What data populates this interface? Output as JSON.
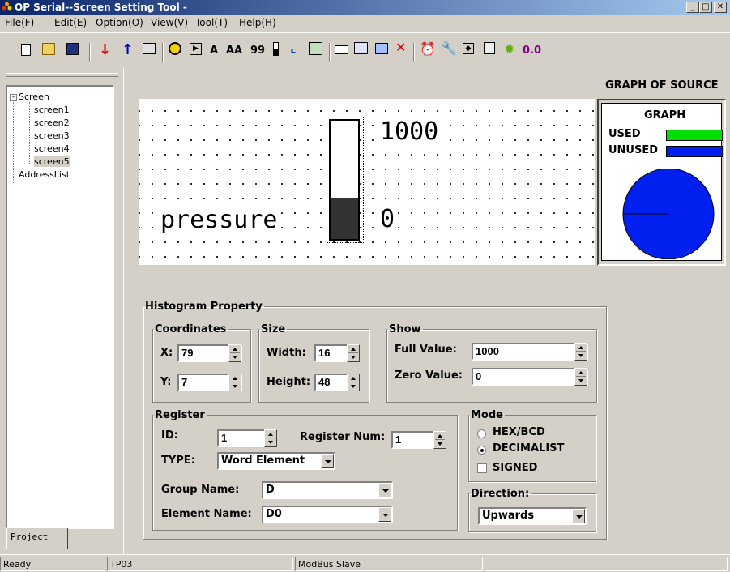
{
  "window": {
    "title": "OP Serial--Screen Setting Tool -"
  },
  "menu": [
    "File(F)",
    "Edit(E)",
    "Option(O)",
    "View(V)",
    "Tool(T)",
    "Help(H)"
  ],
  "toolbar": {
    "text_a": "A",
    "text_aa": "AA",
    "text_99": "99",
    "zoom_value": "0.0"
  },
  "tree": {
    "root": "Screen",
    "screens": [
      "screen1",
      "screen2",
      "screen3",
      "screen4",
      "screen5"
    ],
    "selected": "screen5",
    "address_list": "AddressList",
    "tab": "Project"
  },
  "canvas": {
    "label": "pressure",
    "full_label": "1000",
    "zero_label": "0",
    "bar_fill_fraction": 0.34
  },
  "source": {
    "title": "GRAPH OF SOURCE",
    "graph": "GRAPH",
    "used": "USED",
    "unused": "UNUSED",
    "used_color": "#00e000",
    "unused_color": "#0020f0",
    "used_fraction": 0.0
  },
  "props": {
    "title": "Histogram Property",
    "coordinates": {
      "title": "Coordinates",
      "x_label": "X:",
      "x": "79",
      "y_label": "Y:",
      "y": "7"
    },
    "size": {
      "title": "Size",
      "width_label": "Width:",
      "width": "16",
      "height_label": "Height:",
      "height": "48"
    },
    "show": {
      "title": "Show",
      "full_label": "Full Value:",
      "full": "1000",
      "zero_label": "Zero Value:",
      "zero": "0"
    },
    "register": {
      "title": "Register",
      "id_label": "ID:",
      "id": "1",
      "regnum_label": "Register Num:",
      "regnum": "1",
      "type_label": "TYPE:",
      "type": "Word Element",
      "group_label": "Group Name:",
      "group": "D",
      "element_label": "Element Name:",
      "element": "D0"
    },
    "mode": {
      "title": "Mode",
      "hex": "HEX/BCD",
      "dec": "DECIMALIST",
      "signed": "SIGNED",
      "selected": "DECIMALIST"
    },
    "direction": {
      "title": "Direction:",
      "value": "Upwards"
    }
  },
  "status": {
    "ready": "Ready",
    "device": "TP03",
    "protocol": "ModBus Slave"
  }
}
